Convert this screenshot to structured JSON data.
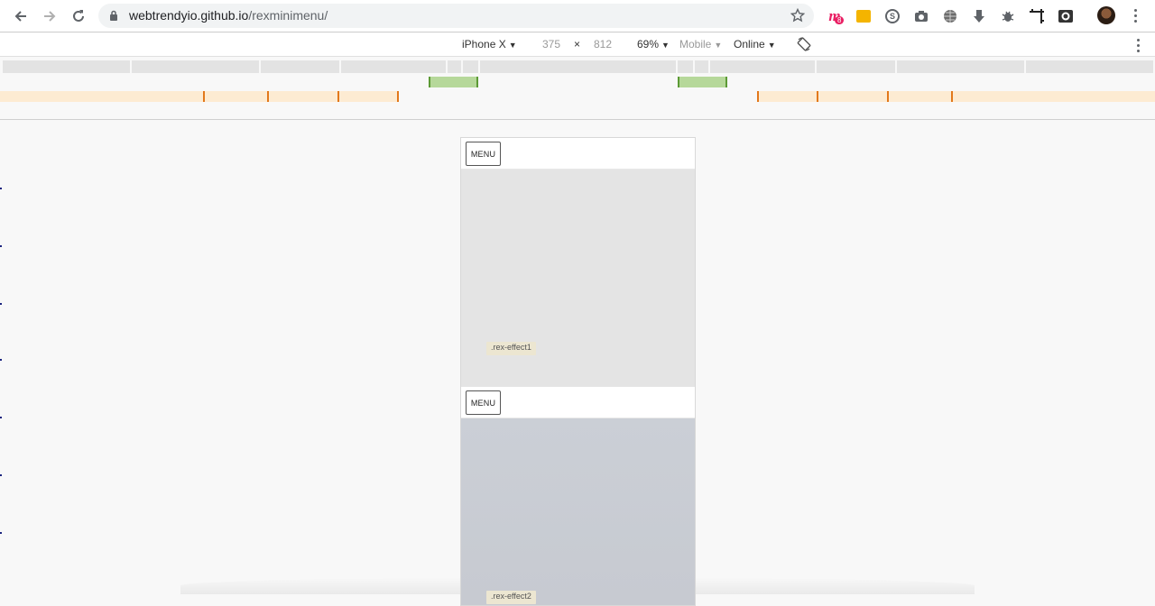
{
  "browser": {
    "url_host": "webtrendyio.github.io",
    "url_path": "/rexminimenu/",
    "extension_badge": "8",
    "icons": [
      "back-icon",
      "forward-icon",
      "reload-icon",
      "lock-icon",
      "star-icon",
      "m-extension-icon",
      "note-extension-icon",
      "skype-icon",
      "camera-icon",
      "globe-icon",
      "download-icon",
      "bug-icon",
      "screenshot-crop-icon",
      "camera-lens-icon",
      "avatar",
      "kebab-menu-icon"
    ]
  },
  "device_toolbar": {
    "device": "iPhone X",
    "width": "375",
    "times": "×",
    "height": "812",
    "zoom": "69%",
    "mode": "Mobile",
    "network": "Online"
  },
  "page": {
    "sections": [
      {
        "menu_label": "MENU",
        "tag": ".rex-effect1",
        "panel_color": "#e4e4e4"
      },
      {
        "menu_label": "MENU",
        "tag": ".rex-effect2",
        "panel_color": "#cbcfd6"
      }
    ]
  },
  "colors": {
    "mq_gray": "#e3e3e3",
    "mq_green": "#b6d89a",
    "mq_orange": "#fdebd2",
    "tick_orange": "#e2781b"
  }
}
